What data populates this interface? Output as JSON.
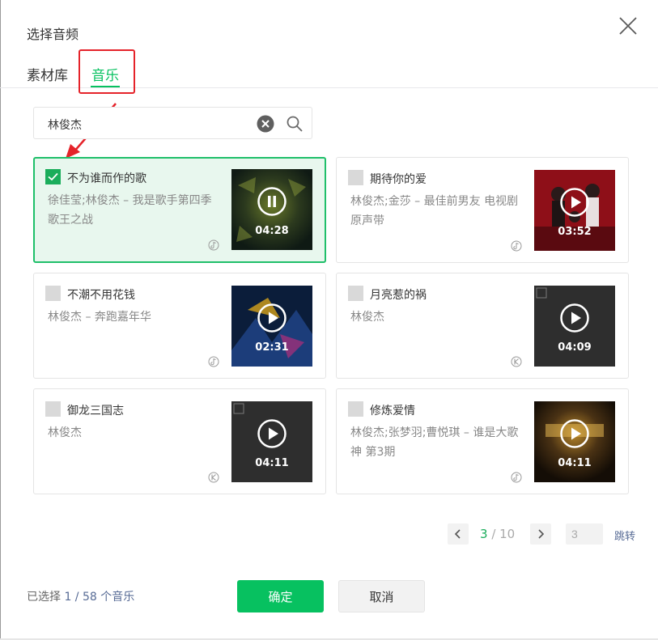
{
  "dialog": {
    "title": "选择音频"
  },
  "tabs": [
    {
      "label": "素材库",
      "active": false
    },
    {
      "label": "音乐",
      "active": true
    }
  ],
  "search": {
    "value": "林俊杰"
  },
  "songs": [
    {
      "title": "不为谁而作的歌",
      "artist": "徐佳莹;林俊杰 – 我是歌手第四季 歌王之战",
      "duration": "04:28",
      "selected": true,
      "playing": true,
      "source_icon": "music-source-icon"
    },
    {
      "title": "期待你的爱",
      "artist": "林俊杰;金莎 – 最佳前男友 电视剧原声带",
      "duration": "03:52",
      "selected": false,
      "playing": false,
      "source_icon": "music-source-icon"
    },
    {
      "title": "不潮不用花钱",
      "artist": "林俊杰 – 奔跑嘉年华",
      "duration": "02:31",
      "selected": false,
      "playing": false,
      "source_icon": "music-source-icon"
    },
    {
      "title": "月亮惹的祸",
      "artist": "林俊杰",
      "duration": "04:09",
      "selected": false,
      "playing": false,
      "source_icon": "kugou-k-icon"
    },
    {
      "title": "御龙三国志",
      "artist": "林俊杰",
      "duration": "04:11",
      "selected": false,
      "playing": false,
      "source_icon": "kugou-k-icon"
    },
    {
      "title": "修炼爱情",
      "artist": "林俊杰;张梦羽;曹悦琪 – 谁是大歌神 第3期",
      "duration": "04:11",
      "selected": false,
      "playing": false,
      "source_icon": "music-source-icon"
    }
  ],
  "pagination": {
    "current": "3",
    "separator": " / ",
    "total": "10",
    "input_value": "3",
    "jump_label": "跳转"
  },
  "footer": {
    "selected_prefix": "已选择 ",
    "selected_count": "1 / 58 个音乐",
    "confirm_label": "确定",
    "cancel_label": "取消"
  },
  "colors": {
    "accent": "#07c160",
    "annotation": "#e5232a",
    "link": "#576b95"
  }
}
